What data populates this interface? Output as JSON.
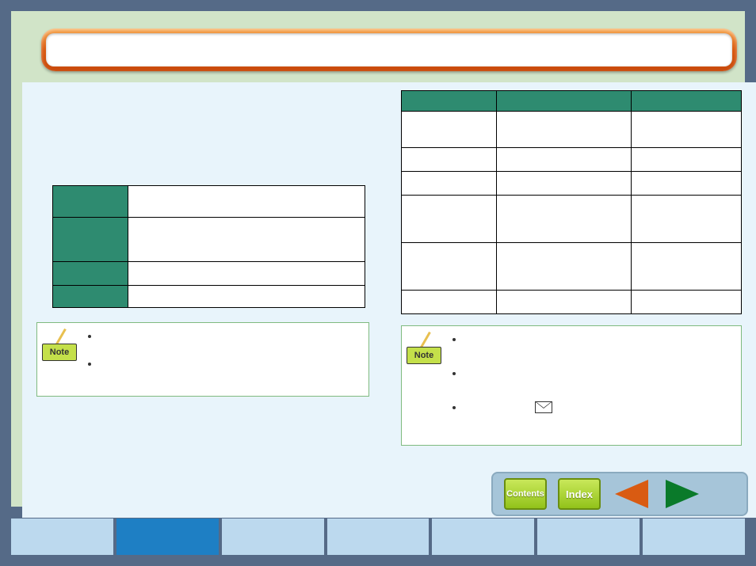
{
  "title": "",
  "left_table": {
    "rows": [
      {
        "label": "",
        "value": ""
      },
      {
        "label": "",
        "value": ""
      },
      {
        "label": "",
        "value": ""
      },
      {
        "label": "",
        "value": ""
      }
    ]
  },
  "right_table": {
    "headers": [
      "",
      "",
      ""
    ],
    "rows": [
      [
        "",
        "",
        ""
      ],
      [
        "",
        "",
        ""
      ],
      [
        "",
        "",
        ""
      ],
      [
        "",
        "",
        ""
      ],
      [
        "",
        "",
        ""
      ],
      [
        "",
        "",
        ""
      ]
    ]
  },
  "left_note": {
    "badge": "Note",
    "items": [
      "",
      ""
    ]
  },
  "right_note": {
    "badge": "Note",
    "items": [
      "",
      "",
      ""
    ]
  },
  "nav": {
    "contents_label": "Contents",
    "index_label": "Index"
  },
  "footer_tabs": [
    "",
    "",
    "",
    "",
    "",
    "",
    ""
  ],
  "footer_active_index": 1
}
